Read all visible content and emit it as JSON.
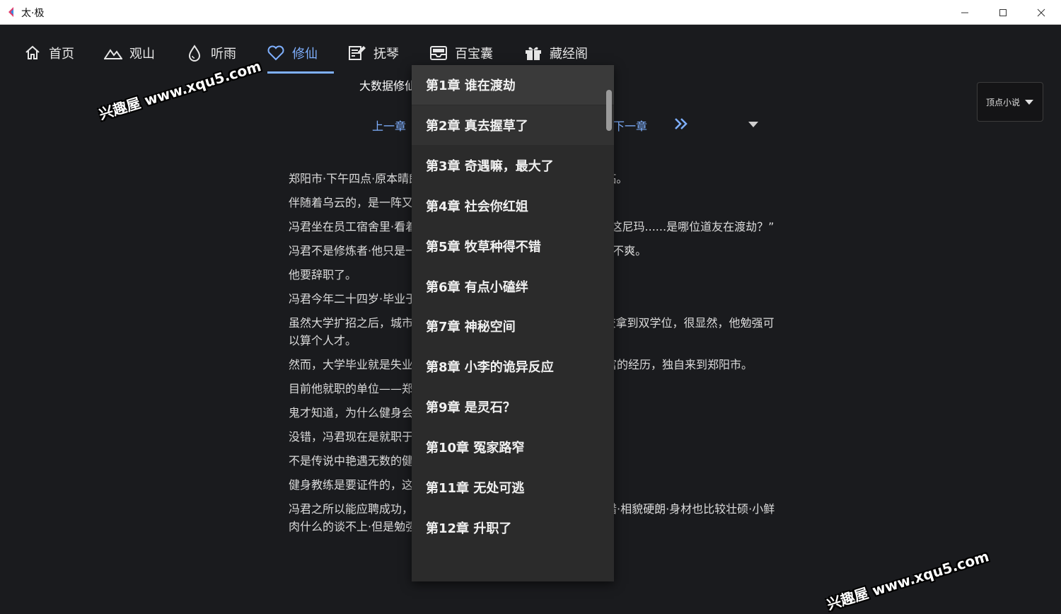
{
  "window": {
    "title": "太·极"
  },
  "nav": {
    "items": [
      {
        "label": "首页",
        "icon": "home-icon"
      },
      {
        "label": "观山",
        "icon": "mountain-icon"
      },
      {
        "label": "听雨",
        "icon": "water-drop-icon"
      },
      {
        "label": "修仙",
        "icon": "heart-icon",
        "active": true
      },
      {
        "label": "抚琴",
        "icon": "edit-note-icon"
      },
      {
        "label": "百宝囊",
        "icon": "inbox-icon"
      },
      {
        "label": "藏经阁",
        "icon": "gift-icon"
      }
    ]
  },
  "book": {
    "title_visible": "大数据修仙"
  },
  "source": {
    "selected": "顶点小说"
  },
  "chapter_nav": {
    "prev": "上一章",
    "next": "下一章",
    "last_icon": "double-chevron-right-icon"
  },
  "content": {
    "paragraphs": [
      "郑阳市·下午四点·原本晴朗的天空忽然布满乌云·黑得有若夜晚降临。",
      "伴随着乌云的，是一阵又一阵的闪电，仿佛世界末日一般。",
      "冯君坐在员工宿舍里·看着窗外的乌云，叹了一顿·重重地叹口气·“这尼玛......是哪位道友在渡劫？”",
      "冯君不是修炼者·他只是一个普通的年轻人·只是因为他的心情极其不爽。",
      "他要辞职了。",
      "冯君今年二十四岁·毕业于985院校·拿到双学位。",
      "虽然大学扩招之后，城市里的大学生多了，但四年里，在985院校拿到双学位，很显然，他勉强可以算个人才。",
      "然而，大学毕业就是失业，他在家乡小城混了两年，然后带着丰富的经历，独自来到郑阳市。",
      "目前他就职的单位——郑阳市某某健身文化娱乐有限公司。",
      "鬼才知道，为什么健身会跟文化娱乐……文体不分家？",
      "没错，冯君现在是就职于一家健身房。",
      "不是传说中艳遇无数的健身教练，而是打扫卫生的小弟。",
      "健身教练是要证件的，这家健身房在郑阳的名气极大。",
      "冯君之所以能应聘成功，一来是他的学历高，二来是他的形象不错·相貌硬朗·身材也比较壮硕·小鲜肉什么的谈不上·但是勉强搭得上“精壮”的边儿。"
    ]
  },
  "chapter_dropdown": {
    "items": [
      "第1章 谁在渡劫",
      "第2章 真去握草了",
      "第3章 奇遇嘛，最大了",
      "第4章 社会你红姐",
      "第5章 牧草种得不错",
      "第6章 有点小磕绊",
      "第7章 神秘空间",
      "第8章 小李的诡异反应",
      "第9章 是灵石？",
      "第10章 冤家路窄",
      "第11章 无处可逃",
      "第12章 升职了"
    ]
  },
  "watermark": {
    "text": "兴趣屋 www.xqu5.com"
  },
  "colors": {
    "accent": "#7fb0ff",
    "background": "#1a1b1e",
    "dropdown": "#2b2b2b"
  }
}
